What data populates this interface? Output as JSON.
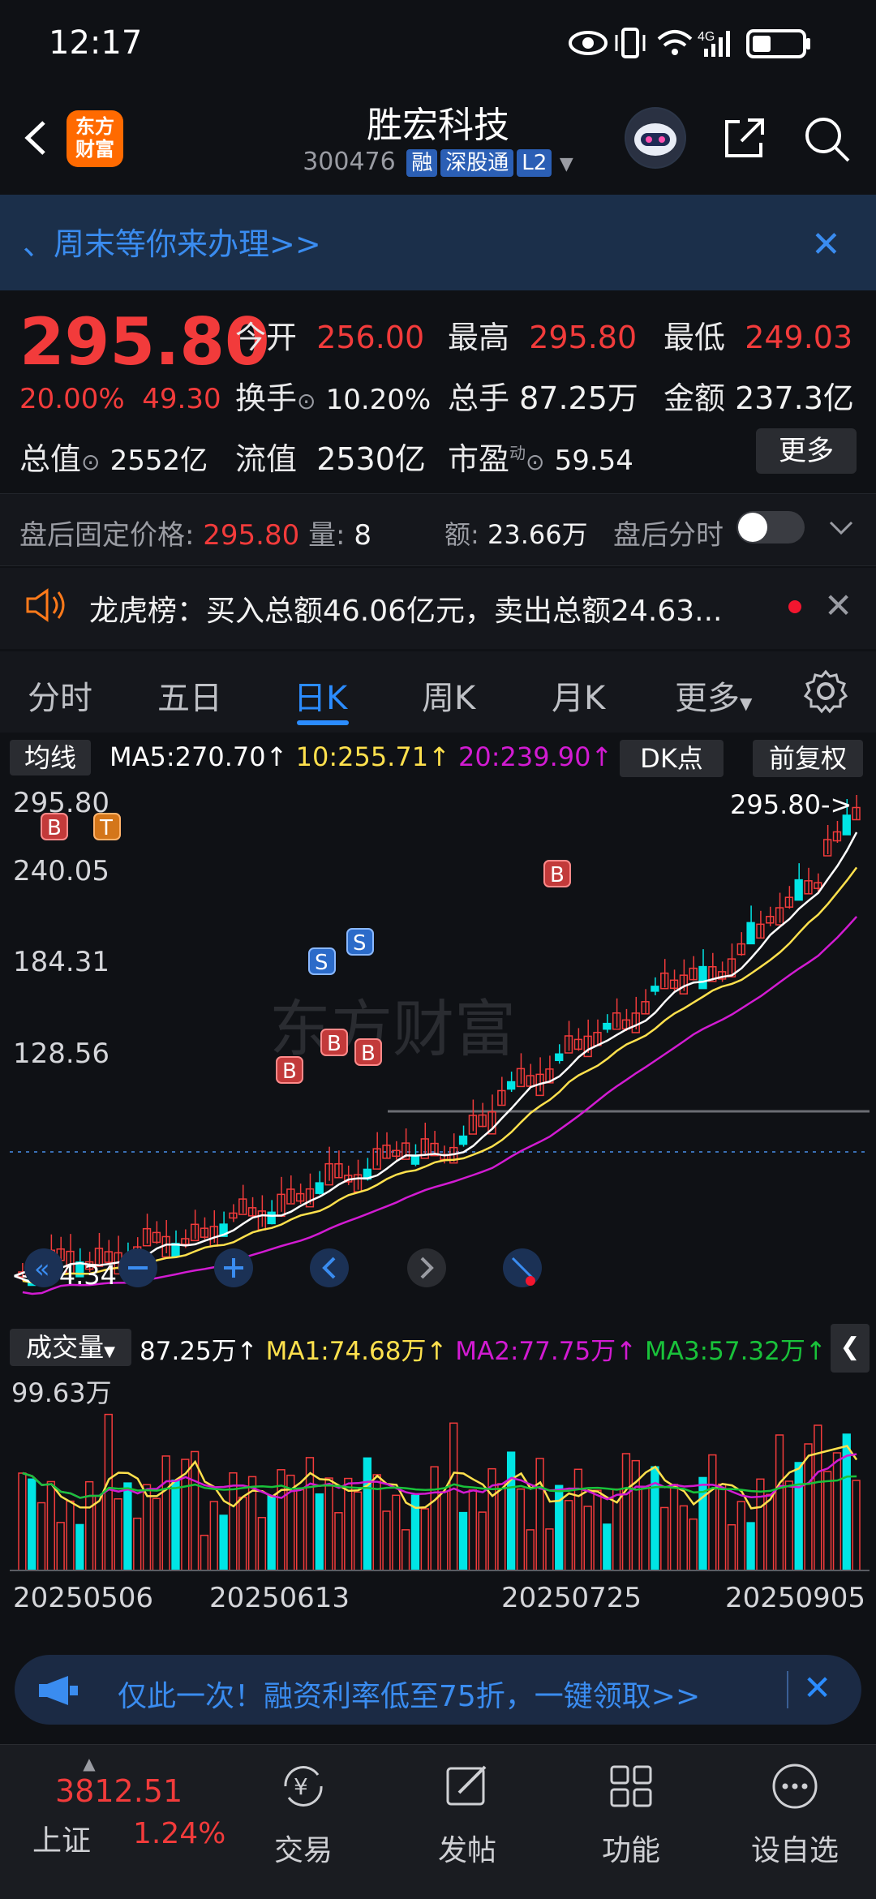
{
  "status": {
    "time": "12:17"
  },
  "header": {
    "back_icon": "back-arrow-icon",
    "brand_logo": "东方财富",
    "stock_name": "胜宏科技",
    "stock_code": "300476",
    "tags": [
      "融",
      "深股通",
      "L2"
    ]
  },
  "banner": {
    "text": "、周末等你来办理>>",
    "close": "✕"
  },
  "quote": {
    "price": "295.80",
    "pct": "20.00%",
    "change": "49.30",
    "open_label": "今开",
    "open": "256.00",
    "high_label": "最高",
    "high": "295.80",
    "low_label": "最低",
    "low": "249.03",
    "turnover_label": "换手",
    "turnover": "10.20%",
    "vol_label": "总手",
    "vol": "87.25万",
    "amount_label": "金额",
    "amount": "237.3亿",
    "mcap_label": "总值",
    "mcap": "2552亿",
    "float_label": "流值",
    "float": "2530亿",
    "pe_label": "市盈",
    "pe_sup": "动",
    "pe": "59.54",
    "more": "更多"
  },
  "after_hours": {
    "price_label": "盘后固定价格:",
    "price": "295.80",
    "qty_label": "量:",
    "qty": "8",
    "amt_label": "额:",
    "amt": "23.66万",
    "timeshare_label": "盘后分时"
  },
  "dragon": {
    "text": "龙虎榜：买入总额46.06亿元，卖出总额24.63..."
  },
  "tabs": [
    "分时",
    "五日",
    "日K",
    "周K",
    "月K",
    "更多"
  ],
  "active_tab": "日K",
  "ma": {
    "label": "均线",
    "ma5": "MA5:270.70↑",
    "ma10": "10:255.71↑",
    "ma20": "20:239.90↑",
    "dk": "DK点",
    "adjust": "前复权"
  },
  "kline": {
    "y_labels": [
      "295.80",
      "240.05",
      "184.31",
      "128.56"
    ],
    "high_marker": "295.80->",
    "low_marker": "<-74.34",
    "watermark": "东方财富"
  },
  "volume": {
    "label": "成交量",
    "vol": "87.25万↑",
    "ma1": "MA1:74.68万↑",
    "ma2": "MA2:77.75万↑",
    "ma3": "MA3:57.32万↑",
    "y_label": "99.63万"
  },
  "dates": [
    "20250506",
    "20250613",
    "20250725",
    "20250905"
  ],
  "promo": {
    "text": "仅此一次！融资利率低至75折，一键领取>>"
  },
  "bottom_nav": {
    "index_value": "3812.51",
    "index_name": "上证",
    "index_pct": "1.24%",
    "items": [
      "交易",
      "发帖",
      "功能",
      "设自选"
    ]
  },
  "colors": {
    "up": "#f23b3b",
    "down": "#00e5e5",
    "ma5": "#ffffff",
    "ma10": "#ffe14d",
    "ma20": "#d21bd2",
    "accent": "#2b8cff"
  }
}
